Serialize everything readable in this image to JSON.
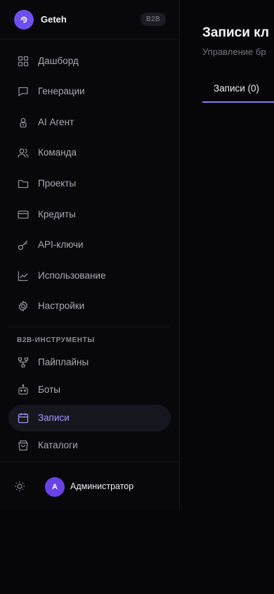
{
  "brand": {
    "name": "Geteh",
    "badge": "B2B"
  },
  "nav": [
    {
      "label": "Дашборд",
      "icon": "dashboard-icon"
    },
    {
      "label": "Генерации",
      "icon": "chat-icon"
    },
    {
      "label": "AI Агент",
      "icon": "agent-icon"
    },
    {
      "label": "Команда",
      "icon": "users-icon"
    },
    {
      "label": "Проекты",
      "icon": "folder-icon"
    },
    {
      "label": "Кредиты",
      "icon": "credit-card-icon"
    },
    {
      "label": "API-ключи",
      "icon": "key-icon"
    },
    {
      "label": "Использование",
      "icon": "chart-icon"
    },
    {
      "label": "Настройки",
      "icon": "gear-icon"
    }
  ],
  "section_title": "B2B-ИНСТРУМЕНТЫ",
  "b2b_nav": [
    {
      "label": "Пайплайны",
      "icon": "pipeline-icon",
      "active": false
    },
    {
      "label": "Боты",
      "icon": "bot-icon",
      "active": false
    },
    {
      "label": "Записи",
      "icon": "calendar-icon",
      "active": true
    },
    {
      "label": "Каталоги",
      "icon": "shopping-bag-icon",
      "active": false
    }
  ],
  "user": {
    "initial": "A",
    "name": "Администратор"
  },
  "main": {
    "title": "Записи кл",
    "subtitle": "Управление бр",
    "tab_label": "Записи (0)"
  },
  "colors": {
    "accent": "#8f78f3",
    "active_text": "#a794ff",
    "logo": "#6f4ef0"
  }
}
